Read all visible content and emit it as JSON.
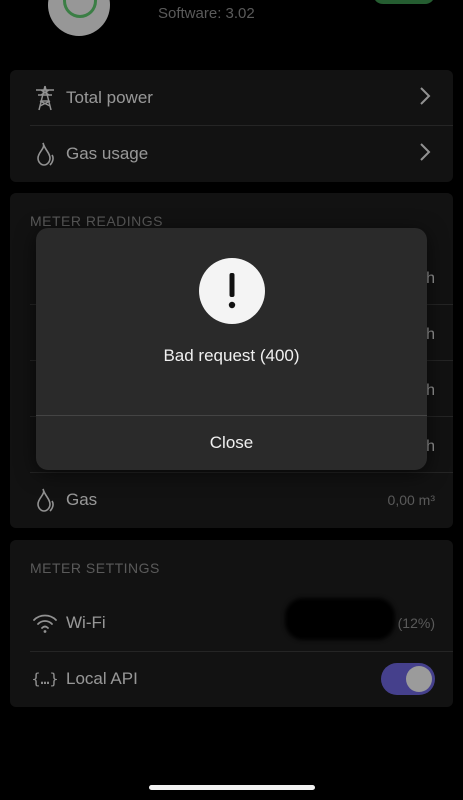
{
  "device": {
    "software_label": "Software: 3.02",
    "accent_green": "#3a8f4c"
  },
  "nav_card": {
    "items": [
      {
        "label": "Total power",
        "icon": "power-tower-icon"
      },
      {
        "label": "Gas usage",
        "icon": "flame-icon"
      }
    ]
  },
  "meter_readings": {
    "title": "METER READINGS",
    "rows": [
      {
        "value_partial": "h"
      },
      {
        "value_partial": "h"
      },
      {
        "value_partial": "h"
      },
      {
        "value_partial": "h"
      }
    ],
    "gas": {
      "label": "Gas",
      "value": "0,00 m³",
      "icon": "flame-icon"
    }
  },
  "meter_settings": {
    "title": "METER SETTINGS",
    "wifi": {
      "label": "Wi-Fi",
      "value": "(12%)",
      "icon": "wifi-icon"
    },
    "local_api": {
      "label": "Local API",
      "icon": "braces-icon",
      "enabled": true,
      "toggle_color": "#6b63d8"
    }
  },
  "dialog": {
    "message": "Bad request (400)",
    "button": "Close",
    "icon": "exclamation-icon"
  }
}
